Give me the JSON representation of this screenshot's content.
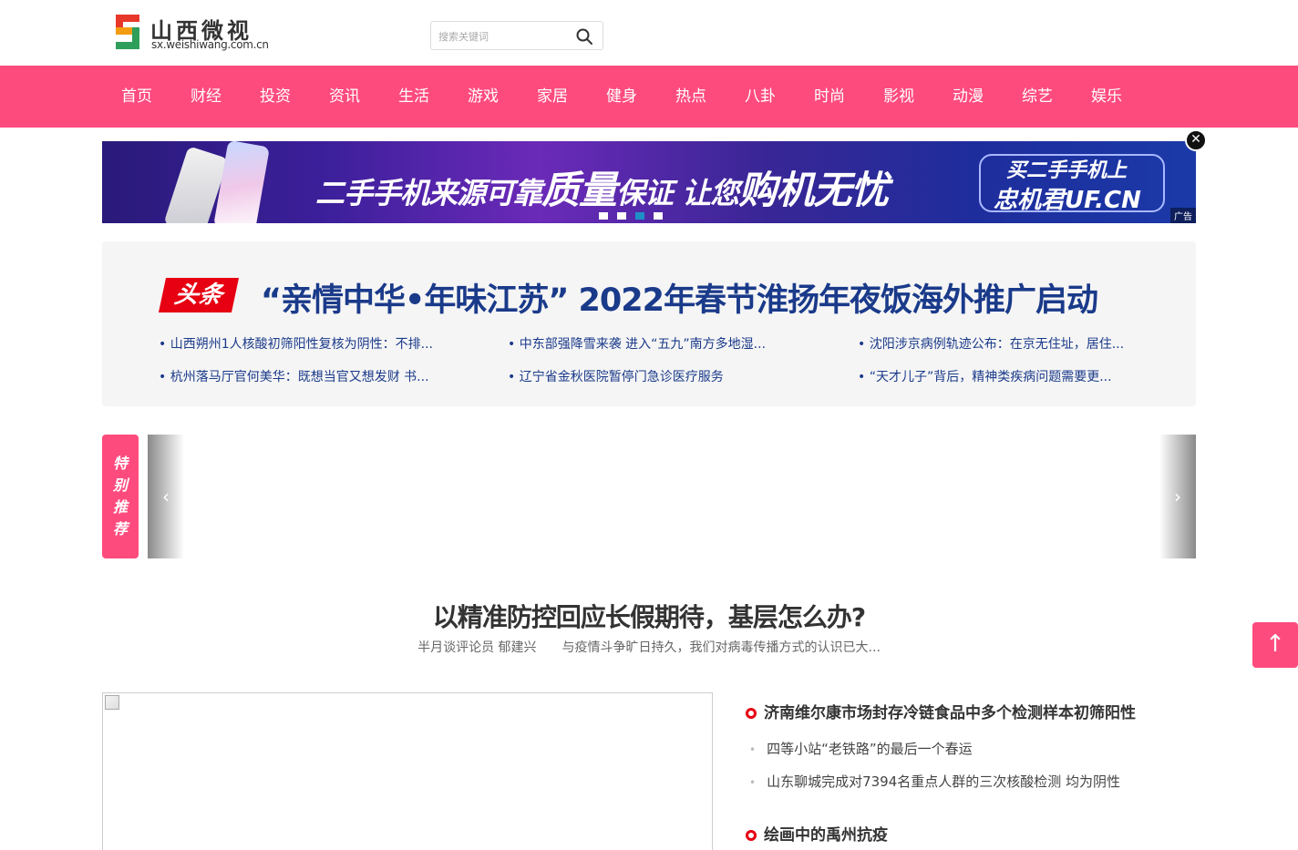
{
  "header": {
    "logo_title": "山西微视",
    "logo_sub": "sx.weishiwang.com.cn",
    "search_placeholder": "搜索关键词"
  },
  "nav": [
    "首页",
    "财经",
    "投资",
    "资讯",
    "生活",
    "游戏",
    "家居",
    "健身",
    "热点",
    "八卦",
    "时尚",
    "影视",
    "动漫",
    "综艺",
    "娱乐"
  ],
  "banner": {
    "slogan_a": "二手手机来源可靠",
    "slogan_b": "质量",
    "slogan_c": "保证 让您",
    "slogan_d": "购机无忧",
    "right_line1": "买二手手机上",
    "right_line2": "忠机君UF.CN",
    "ad_label": "广告",
    "close_symbol": "✕",
    "active_dot": 3
  },
  "headline": {
    "badge": "头条",
    "title": "“亲情中华•年味江苏” 2022年春节淮扬年夜饭海外推广启动",
    "links": [
      "山西朔州1人核酸初筛阳性复核为阴性：不排...",
      "中东部强降雪来袭 进入“五九”南方多地湿...",
      "沈阳涉京病例轨迹公布：在京无住址，居住...",
      "杭州落马厅官何美华：既想当官又想发财 书...",
      "辽宁省金秋医院暂停门急诊医疗服务",
      " “天才儿子”背后，精神类疾病问题需要更..."
    ]
  },
  "recommend": {
    "tag": [
      "特",
      "别",
      "推",
      "荐"
    ],
    "prev": "‹",
    "next": "›"
  },
  "feature": {
    "title": "以精准防控回应长假期待，基层怎么办?",
    "author": "半月谈评论员 郁建兴",
    "summary": "与疫情斗争旷日持久，我们对病毒传播方式的认识已大..."
  },
  "news": {
    "group1_head": "济南维尔康市场封存冷链食品中多个检测样本初筛阳性",
    "group1_items": [
      "四等小站“老铁路”的最后一个春运",
      "山东聊城完成对7394名重点人群的三次核酸检测 均为阴性"
    ],
    "group2_head": "绘画中的禹州抗疫"
  },
  "to_top": "↑",
  "colors": {
    "nav_bg": "#fe4b7e",
    "headline_text": "#1a3a8a",
    "badge_red": "#e60012"
  }
}
